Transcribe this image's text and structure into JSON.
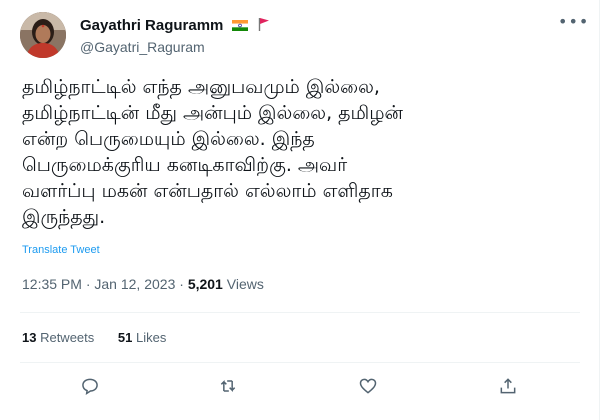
{
  "user": {
    "display_name": "Gayathri Raguramm",
    "handle": "@Gayatri_Raguram",
    "badges": [
      "india-flag-icon",
      "red-flag-icon"
    ]
  },
  "tweet": {
    "text": "தமிழ்நாட்டில் எந்த அனுபவமும் இல்லை,\nதமிழ்நாட்டின் மீது அன்பும் இல்லை, தமிழன்\nஎன்ற பெருமையும் இல்லை. இந்த\nபெருமைக்குரிய கனடிகாவிற்கு. அவர்\nவளர்ப்பு மகன் என்பதால் எல்லாம் எளிதாக\nஇருந்தது."
  },
  "translate_label": "Translate Tweet",
  "meta": {
    "time": "12:35 PM",
    "separator1": " · ",
    "date": "Jan 12, 2023",
    "separator2": " · ",
    "views_count": "5,201",
    "views_label": " Views"
  },
  "stats": {
    "retweets_count": "13",
    "retweets_label": " Retweets",
    "likes_count": "51",
    "likes_label": " Likes"
  },
  "colors": {
    "link": "#1d9bf0",
    "muted": "#536471",
    "text": "#0f1419"
  }
}
